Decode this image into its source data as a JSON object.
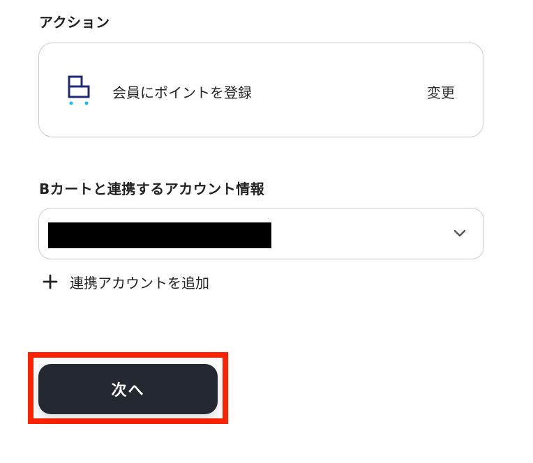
{
  "sections": {
    "action_label": "アクション",
    "account_label": "Bカートと連携するアカウント情報"
  },
  "action_card": {
    "app_icon": "bcart-logo-icon",
    "title": "会員にポイントを登録",
    "change_label": "変更"
  },
  "account_select": {
    "value_redacted": true,
    "chevron_icon": "chevron-down-icon"
  },
  "add_account": {
    "icon": "plus-icon",
    "label": "連携アカウントを追加"
  },
  "next_button": {
    "label": "次へ"
  },
  "colors": {
    "button_bg": "#242830",
    "highlight": "#ff2200",
    "logo_navy": "#1e2a78",
    "logo_cyan": "#1fb6e8",
    "border": "#c9cdd3"
  }
}
